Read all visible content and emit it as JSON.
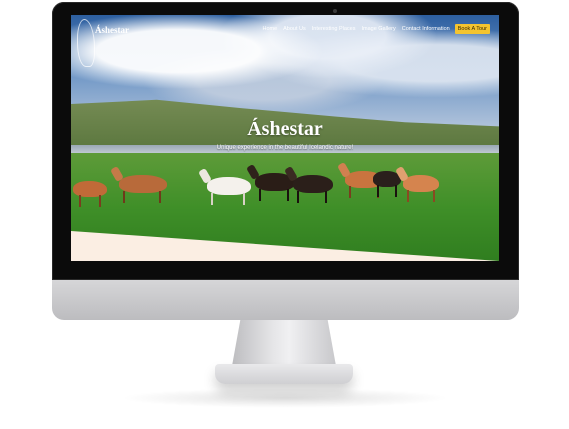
{
  "site": {
    "logo_text": "Áshestar",
    "nav": [
      {
        "label": "Home"
      },
      {
        "label": "About Us"
      },
      {
        "label": "Interesting Places"
      },
      {
        "label": "Image Gallery"
      },
      {
        "label": "Contact Information"
      }
    ],
    "cta_label": "Book A Tour",
    "cta_color": "#f4c430"
  },
  "hero": {
    "title": "Áshestar",
    "subtitle": "Unique experience in the beautiful Icelandic nature!"
  }
}
